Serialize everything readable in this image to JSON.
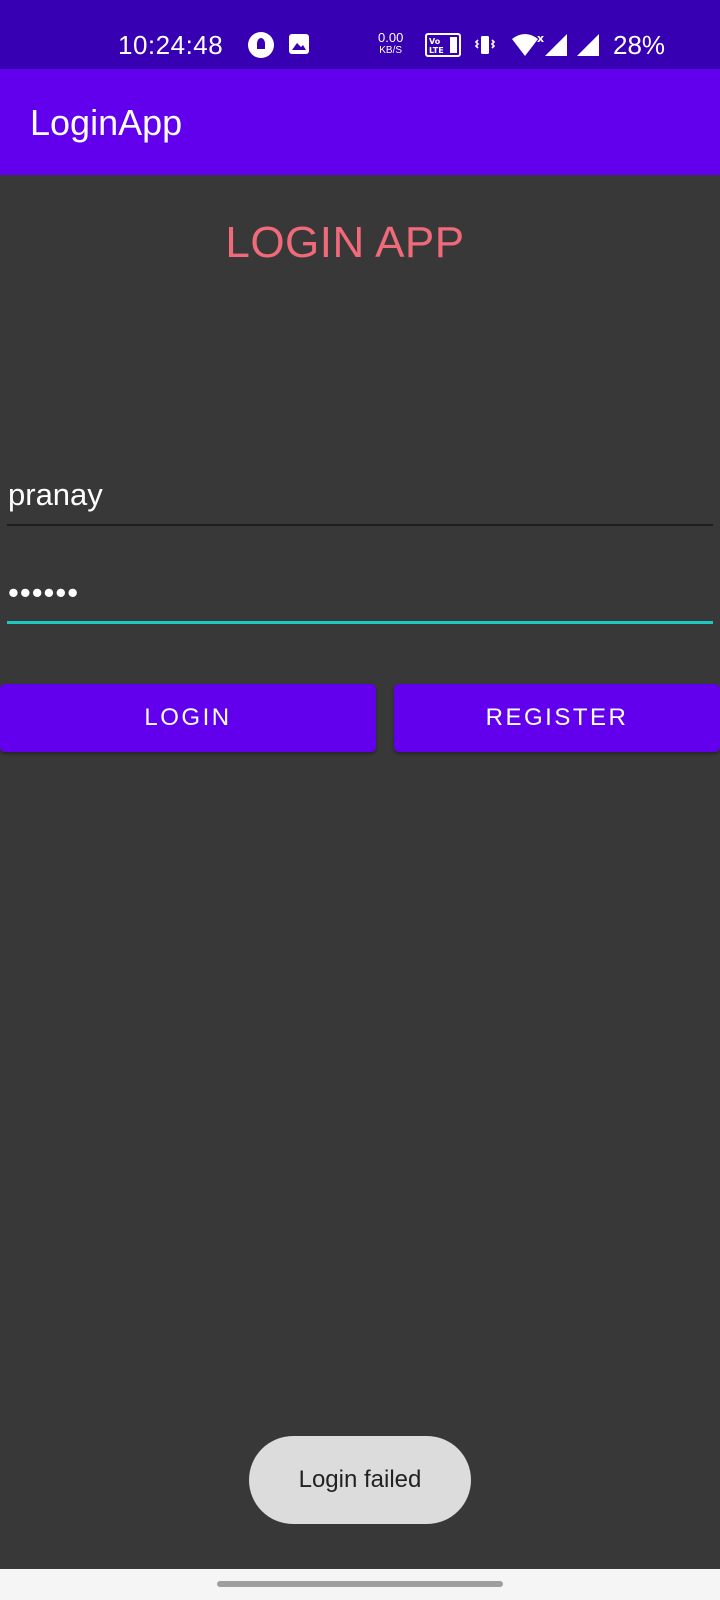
{
  "status_bar": {
    "time": "10:24:48",
    "net_speed_value": "0.00",
    "net_speed_unit": "KB/S",
    "battery": "28%",
    "icons": [
      "app-notification-icon",
      "gallery-icon",
      "volte-icon",
      "vibrate-icon",
      "wifi-icon",
      "signal-icon",
      "signal-icon"
    ]
  },
  "app_bar": {
    "title": "LoginApp"
  },
  "main": {
    "heading": "LOGIN APP",
    "username_value": "pranay",
    "password_value": "••••••",
    "login_label": "LOGIN",
    "register_label": "REGISTER"
  },
  "toast": {
    "message": "Login failed"
  },
  "colors": {
    "status_bar": "#3700b3",
    "primary": "#6200ee",
    "background": "#383838",
    "heading": "#f06a7a",
    "focus_accent": "#1ec8c0"
  }
}
